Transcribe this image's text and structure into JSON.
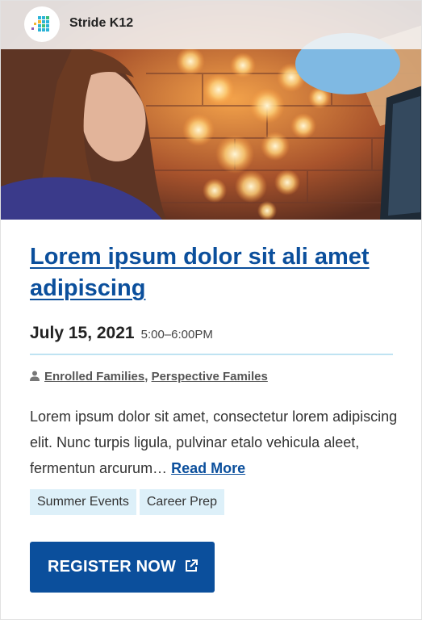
{
  "brand": {
    "name": "Stride K12",
    "logo_icon": "stride-logo-icon"
  },
  "hero": {
    "image_icon": "student-laptop-string-lights-photo"
  },
  "event": {
    "title": "Lorem ipsum dolor sit ali amet adipiscing",
    "date": "July 15, 2021",
    "time": "5:00–6:00PM",
    "audience_icon": "person-icon",
    "audience": [
      "Enrolled Families",
      "Perspective Familes"
    ],
    "audience_separator": ",",
    "description": "Lorem ipsum dolor sit amet, consectetur lorem adipiscing elit. Nunc turpis ligula, pulvinar etalo vehicula aleet, fermentun arcurum…",
    "read_more": "Read More",
    "tags": [
      "Summer Events",
      "Career Prep"
    ]
  },
  "register": {
    "label": "REGISTER NOW",
    "icon": "external-link-icon"
  },
  "colors": {
    "brand_blue": "#0b4f9c",
    "divider": "#bfe3f2",
    "tag_bg": "#ddf0f9"
  }
}
